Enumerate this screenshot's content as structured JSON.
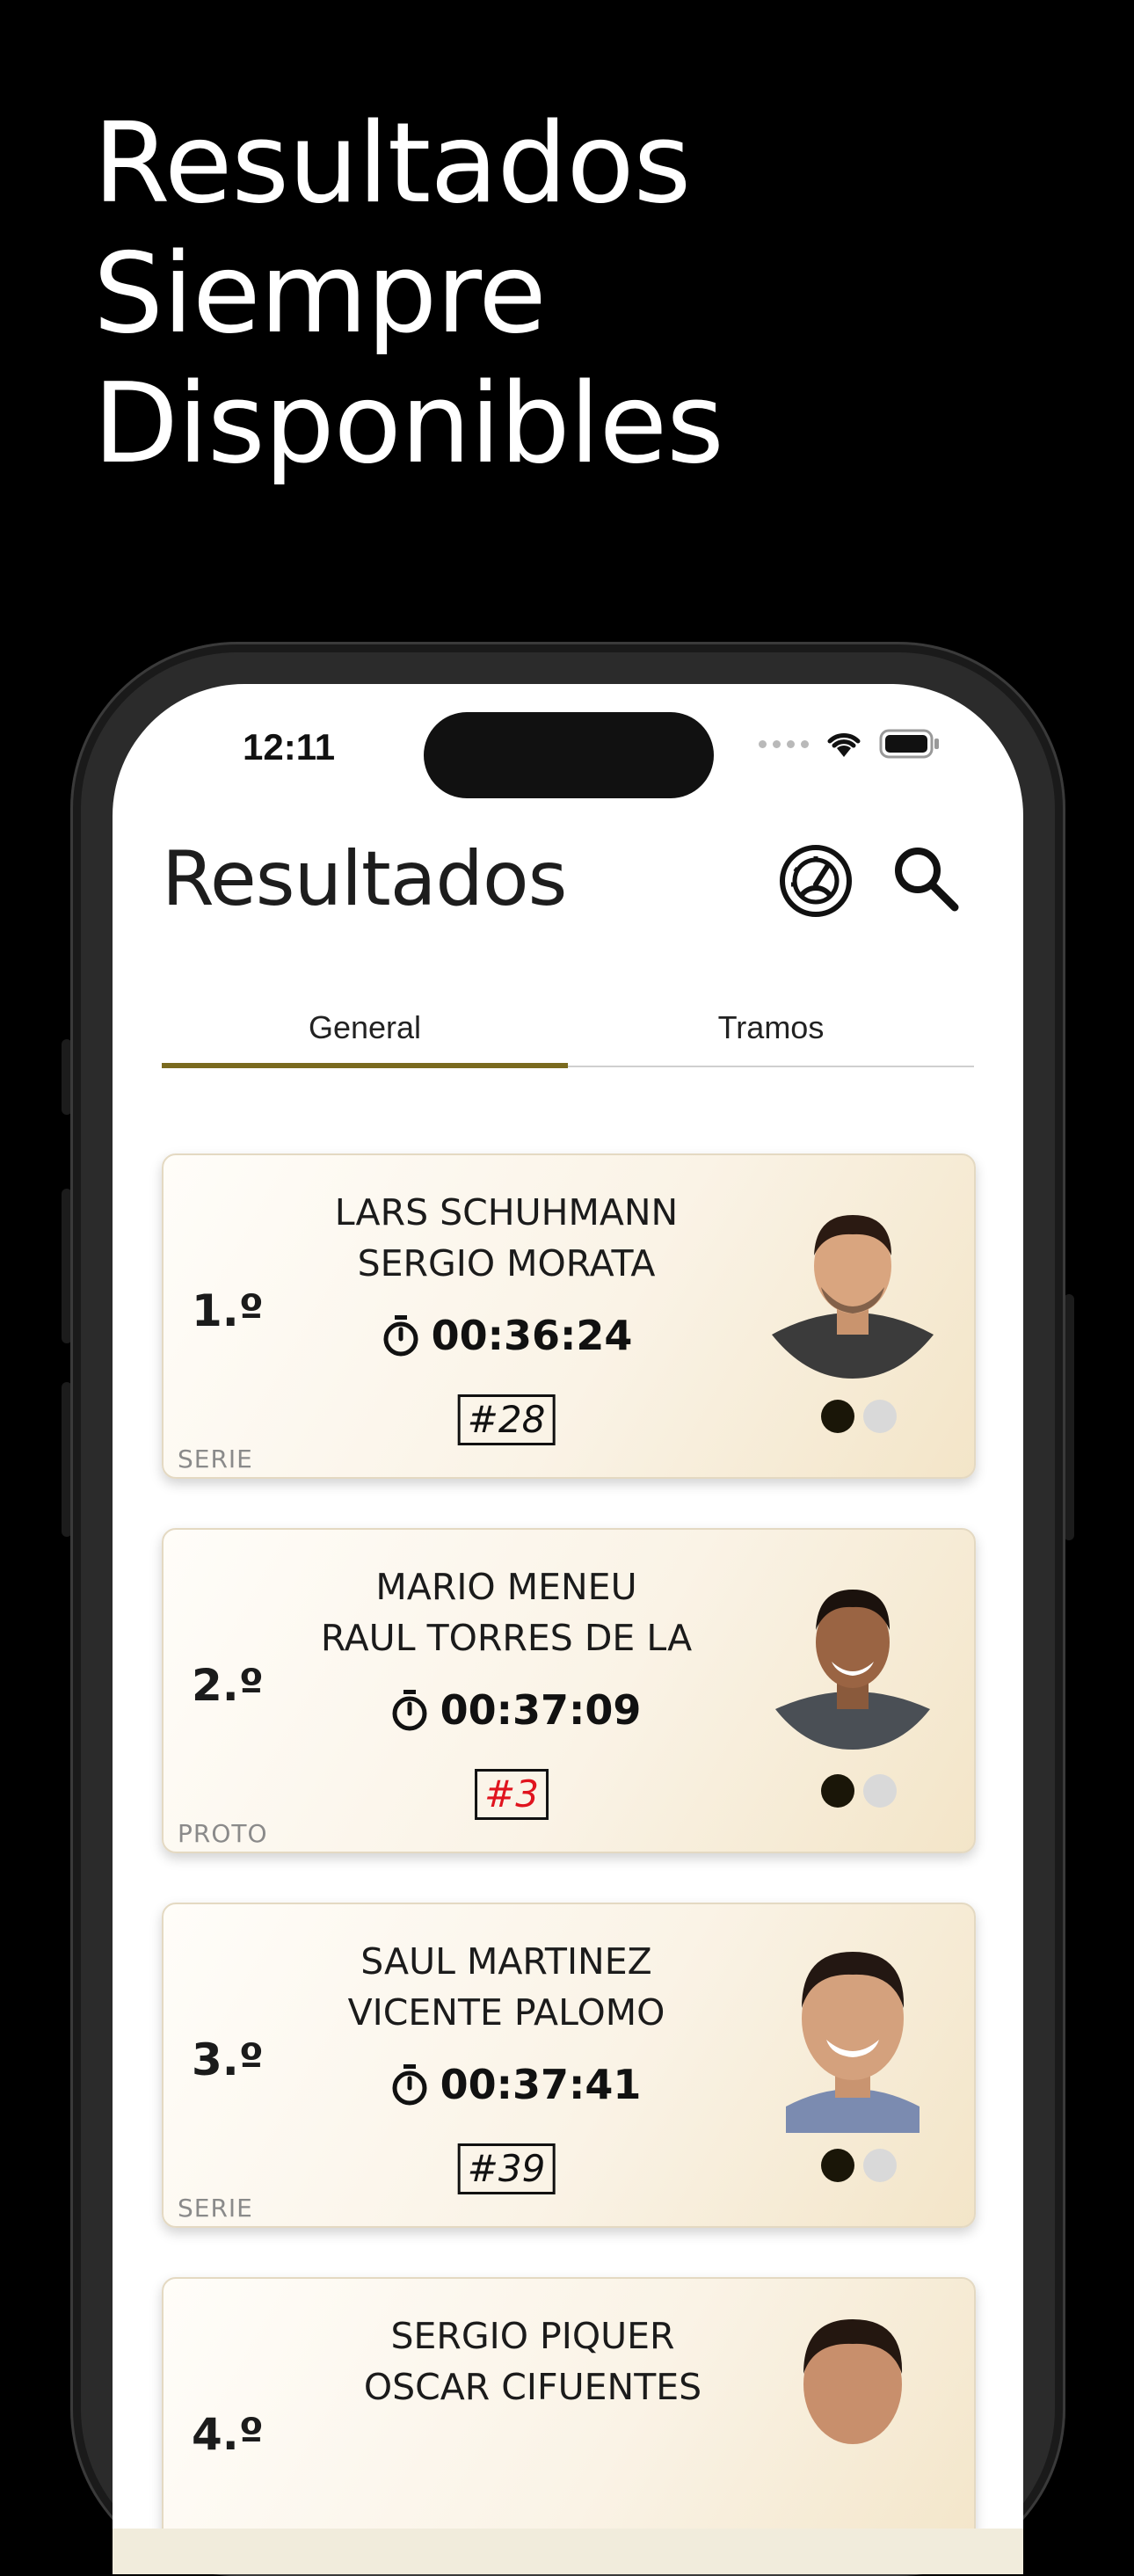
{
  "hero": {
    "line1": "Resultados",
    "line2": "Siempre",
    "line3": "Disponibles"
  },
  "status_bar": {
    "time": "12:11"
  },
  "header": {
    "title": "Resultados",
    "icons": [
      "speedometer-icon",
      "search-icon"
    ]
  },
  "tabs": [
    {
      "label": "General",
      "selected": true
    },
    {
      "label": "Tramos",
      "selected": false
    }
  ],
  "accent_color": "#7a6a1f",
  "results": [
    {
      "position": "1.º",
      "driver": "LARS SCHUHMANN",
      "codriver": "SERGIO MORATA",
      "time": "00:36:24",
      "number": "#28",
      "number_color": "#111111",
      "category": "SERIE"
    },
    {
      "position": "2.º",
      "driver": "MARIO MENEU",
      "codriver": "RAUL TORRES DE LA",
      "time": "00:37:09",
      "number": "#3",
      "number_color": "#e0141e",
      "category": "PROTO"
    },
    {
      "position": "3.º",
      "driver": "SAUL MARTINEZ",
      "codriver": "VICENTE PALOMO",
      "time": "00:37:41",
      "number": "#39",
      "number_color": "#111111",
      "category": "SERIE"
    },
    {
      "position": "4.º",
      "driver": "SERGIO PIQUER",
      "codriver": "OSCAR CIFUENTES",
      "time": "",
      "number": "",
      "number_color": "#111111",
      "category": ""
    }
  ]
}
